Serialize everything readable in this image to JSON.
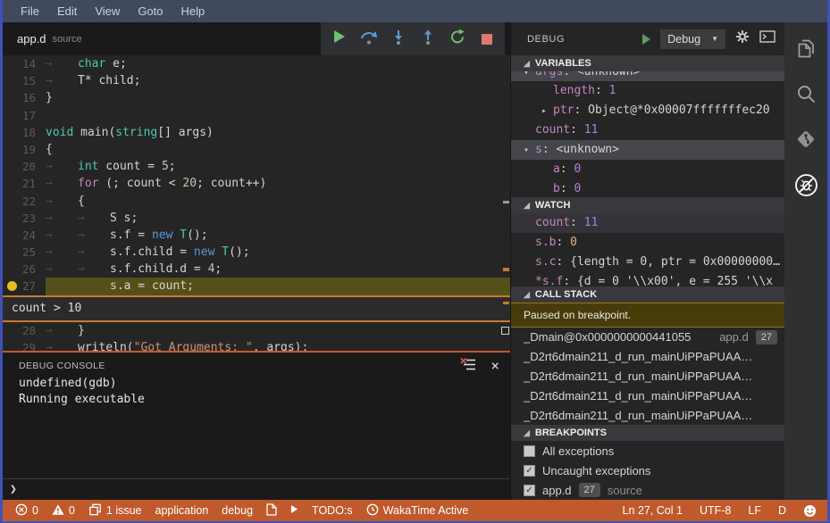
{
  "colors": {
    "accent_orange": "#C05A2C",
    "window_border": "#3f51b5",
    "breakpoint_yellow": "#e5be27"
  },
  "menu_bar": {
    "items": [
      "File",
      "Edit",
      "View",
      "Goto",
      "Help"
    ]
  },
  "editor_tab": {
    "name": "app.d",
    "kind": "source"
  },
  "debug_toolbar": {
    "buttons": [
      "continue",
      "step-over",
      "step-into",
      "step-out",
      "restart",
      "stop"
    ]
  },
  "code": {
    "lines": [
      {
        "n": 14,
        "tokens": [
          [
            "tab"
          ],
          [
            "kt",
            "char"
          ],
          [
            "pl",
            " e;"
          ]
        ]
      },
      {
        "n": 15,
        "tokens": [
          [
            "tab"
          ],
          [
            "pl",
            "T* child;"
          ]
        ]
      },
      {
        "n": 16,
        "tokens": [
          [
            "pl",
            "}"
          ]
        ]
      },
      {
        "n": 17,
        "tokens": []
      },
      {
        "n": 18,
        "tokens": [
          [
            "kt",
            "void"
          ],
          [
            "pl",
            " main("
          ],
          [
            "kt",
            "string"
          ],
          [
            "pl",
            "[] args)"
          ]
        ]
      },
      {
        "n": 19,
        "tokens": [
          [
            "pl",
            "{"
          ]
        ]
      },
      {
        "n": 20,
        "tokens": [
          [
            "tab"
          ],
          [
            "kt",
            "int"
          ],
          [
            "pl",
            " count = "
          ],
          [
            "num",
            "5"
          ],
          [
            "pl",
            ";"
          ]
        ]
      },
      {
        "n": 21,
        "tokens": [
          [
            "tab"
          ],
          [
            "kc",
            "for"
          ],
          [
            "pl",
            " (; count < "
          ],
          [
            "num",
            "20"
          ],
          [
            "pl",
            "; count++)"
          ]
        ]
      },
      {
        "n": 22,
        "tokens": [
          [
            "tab"
          ],
          [
            "pl",
            "{"
          ]
        ]
      },
      {
        "n": 23,
        "tokens": [
          [
            "tab"
          ],
          [
            "tab"
          ],
          [
            "pl",
            "S s;"
          ]
        ]
      },
      {
        "n": 24,
        "tokens": [
          [
            "tab"
          ],
          [
            "tab"
          ],
          [
            "pl",
            "s.f = "
          ],
          [
            "kn",
            "new"
          ],
          [
            "pl",
            " "
          ],
          [
            "kt",
            "T"
          ],
          [
            "pl",
            "();"
          ]
        ]
      },
      {
        "n": 25,
        "tokens": [
          [
            "tab"
          ],
          [
            "tab"
          ],
          [
            "pl",
            "s.f.child = "
          ],
          [
            "kn",
            "new"
          ],
          [
            "pl",
            " "
          ],
          [
            "kt",
            "T"
          ],
          [
            "pl",
            "();"
          ]
        ]
      },
      {
        "n": 26,
        "tokens": [
          [
            "tab"
          ],
          [
            "tab"
          ],
          [
            "pl",
            "s.f.child.d = "
          ],
          [
            "num",
            "4"
          ],
          [
            "pl",
            ";"
          ]
        ]
      },
      {
        "n": 27,
        "current": true,
        "breakpoint": true,
        "tokens": [
          [
            "tab"
          ],
          [
            "tab"
          ],
          [
            "pl",
            "s.a = count;"
          ]
        ]
      },
      {
        "n": 28,
        "tokens": [
          [
            "tab"
          ],
          [
            "pl",
            "}"
          ]
        ]
      },
      {
        "n": 29,
        "tokens": [
          [
            "tab"
          ],
          [
            "pl",
            "writeln("
          ],
          [
            "str",
            "\"Got Arguments: \""
          ],
          [
            "pl",
            ", args);"
          ]
        ]
      }
    ]
  },
  "breakpoint_widget": {
    "expression": "count > 10"
  },
  "debug_console": {
    "title": "DEBUG CONSOLE",
    "output": [
      "undefined(gdb)",
      "Running executable"
    ],
    "prompt": "❯"
  },
  "debug_panel": {
    "title": "DEBUG",
    "config_selector": "Debug",
    "sections": {
      "variables": "VARIABLES",
      "watch": "WATCH",
      "call_stack": "CALL STACK",
      "breakpoints": "BREAKPOINTS"
    },
    "variables": [
      {
        "twisty": "▾",
        "name": "args",
        "value": "<unknown>",
        "selected": true,
        "clipped": true,
        "indent": 0
      },
      {
        "name": "length",
        "value": "1",
        "vclass": "num",
        "indent": 1
      },
      {
        "twisty": "▸",
        "name": "ptr",
        "value": "Object@*0x00007fffffffec20",
        "indent": 1
      },
      {
        "name": "count",
        "value": "11",
        "vclass": "num",
        "indent": 0
      },
      {
        "twisty": "▾",
        "name": "s",
        "value": "<unknown>",
        "selected": true,
        "indent": 0
      },
      {
        "name": "a",
        "value": "0",
        "vclass": "num",
        "indent": 1
      },
      {
        "name": "b",
        "value": "0",
        "vclass": "num",
        "indent": 1,
        "h": 20
      }
    ],
    "watch": [
      {
        "name": "count",
        "value": "11",
        "vclass": "num",
        "selected": true
      },
      {
        "name": "s.b",
        "value": "0",
        "vclass": "chr"
      },
      {
        "name": "s.c",
        "value": "{length = 0, ptr = 0x00000000…"
      },
      {
        "name": "*s.f",
        "value": "{d = 0 '\\\\x00', e = 255 '\\\\x",
        "h": 16
      }
    ],
    "call_stack": {
      "status": "Paused on breakpoint.",
      "frames": [
        {
          "name": "_Dmain@0x0000000000441055",
          "file": "app.d",
          "line": "27"
        },
        {
          "name": "_D2rt6dmain211_d_run_mainUiPPaPUAA…"
        },
        {
          "name": "_D2rt6dmain211_d_run_mainUiPPaPUAA…"
        },
        {
          "name": "_D2rt6dmain211_d_run_mainUiPPaPUAA…"
        },
        {
          "name": "_D2rt6dmain211_d_run_mainUiPPaPUAA…",
          "h": 21
        }
      ]
    },
    "breakpoints": [
      {
        "checked": false,
        "label": "All exceptions"
      },
      {
        "checked": true,
        "label": "Uncaught exceptions"
      },
      {
        "checked": true,
        "label": "app.d",
        "badge": "27",
        "suffix": "source"
      }
    ]
  },
  "activity_bar": {
    "icons": [
      "files",
      "search",
      "source-control",
      "debug"
    ],
    "active": "debug"
  },
  "status_bar": {
    "errors": "0",
    "warnings": "0",
    "issues": "1 issue",
    "run_config": "application",
    "mode": "debug",
    "todos": "TODO:s",
    "wakatime": "WakaTime Active",
    "line_col": "Ln 27, Col 1",
    "encoding": "UTF-8",
    "eol": "LF",
    "language": "D"
  }
}
